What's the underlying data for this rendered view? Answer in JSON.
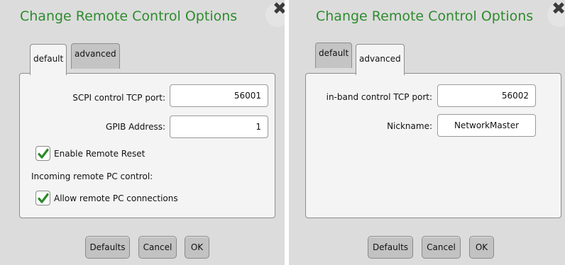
{
  "left": {
    "title": "Change Remote Control Options",
    "close_glyph": "✖",
    "tabs": [
      {
        "label": "default",
        "active": true
      },
      {
        "label": "advanced",
        "active": false
      }
    ],
    "scpi_port": {
      "label": "SCPI control TCP port:",
      "value": "56001"
    },
    "gpib_address": {
      "label": "GPIB Address:",
      "value": "1"
    },
    "enable_remote_reset": {
      "label": "Enable Remote Reset",
      "checked": true
    },
    "incoming_label": "Incoming remote PC control:",
    "allow_remote_pc": {
      "label": "Allow remote PC connections",
      "checked": true
    },
    "buttons": {
      "defaults": "Defaults",
      "cancel": "Cancel",
      "ok": "OK"
    }
  },
  "right": {
    "title": "Change Remote Control Options",
    "close_glyph": "✖",
    "tabs": [
      {
        "label": "default",
        "active": false
      },
      {
        "label": "advanced",
        "active": true
      }
    ],
    "inband_port": {
      "label": "in-band control TCP port:",
      "value": "56002"
    },
    "nickname": {
      "label": "Nickname:",
      "value": "NetworkMaster"
    },
    "buttons": {
      "defaults": "Defaults",
      "cancel": "Cancel",
      "ok": "OK"
    }
  },
  "colors": {
    "title": "#2e8b2e",
    "check": "#2a8a2a",
    "panel_bg": "#dcdcdc",
    "content_bg": "#f4f4f4"
  }
}
